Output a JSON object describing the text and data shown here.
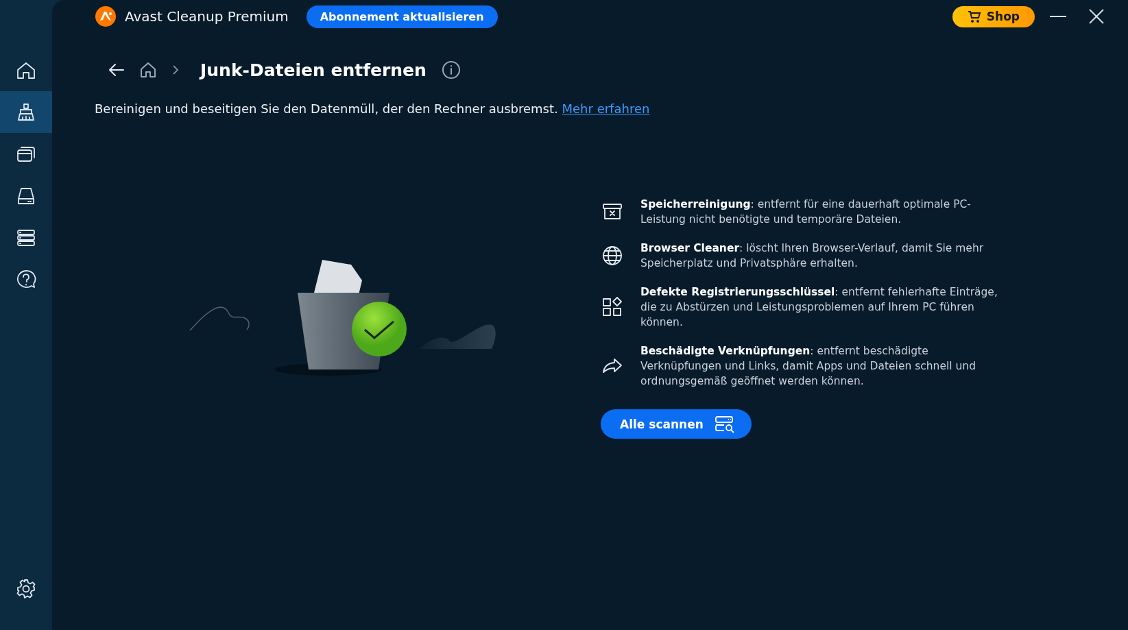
{
  "sidebar": {
    "items": [
      {
        "kind": "home",
        "selected": false
      },
      {
        "kind": "broom",
        "selected": true
      },
      {
        "kind": "windows",
        "selected": false
      },
      {
        "kind": "drive",
        "selected": false
      },
      {
        "kind": "stack",
        "selected": false
      },
      {
        "kind": "help",
        "selected": false
      }
    ],
    "bottom_items": [
      {
        "kind": "settings",
        "selected": false
      }
    ]
  },
  "window": {
    "title": "Avast Cleanup Premium",
    "upgrade_button": "Abonnement aktualisieren",
    "shop_button": "Shop"
  },
  "page": {
    "title": "Junk-Dateien entfernen",
    "description": "Bereinigen und beseitigen Sie den Datenmüll, der den Rechner ausbremst.",
    "link": "Mehr erfahren"
  },
  "features": [
    {
      "kind": "archive",
      "text": "**Speicherreinigung**: entfernt für eine dauerhaft optimale PC-Leistung nicht benötigte und temporäre Dateien."
    },
    {
      "kind": "globe",
      "text": "**Browser Cleaner**: löscht Ihren Browser-Verlauf, damit Sie mehr Speicherplatz und Privatsphäre erhalten."
    },
    {
      "kind": "apps",
      "text": "**Defekte Registrierungsschlüssel**: entfernt fehlerhafte Einträge, die zu Abstürzen und Leistungsproblemen auf Ihrem PC führen können."
    },
    {
      "kind": "share",
      "text": "**Beschädigte Verknüpfungen**: entfernt beschädigte Verknüpfungen und Links, damit Apps und Dateien schnell und ordnungsgemäß geöffnet werden können."
    }
  ],
  "scan_button": "Alle scannen"
}
